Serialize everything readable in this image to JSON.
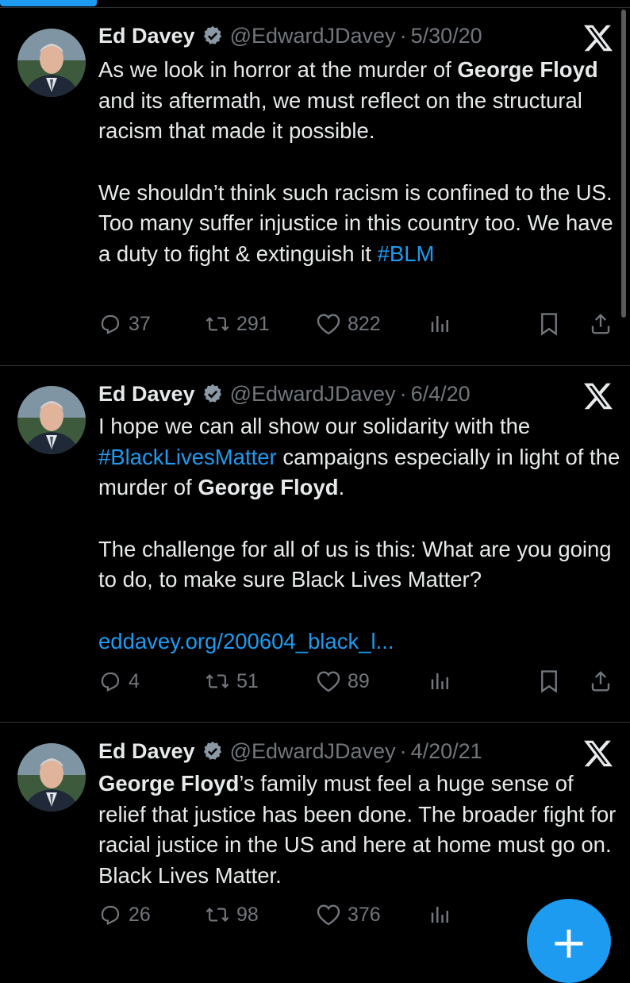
{
  "tweets": [
    {
      "name": "Ed Davey",
      "handle": "@EdwardJDavey",
      "dot": "·",
      "date": "5/30/20",
      "paragraphs": [
        [
          {
            "text": "As we look in horror at the murder of ",
            "style": "normal"
          },
          {
            "text": "George Floyd",
            "style": "bold"
          },
          {
            "text": " and its aftermath, we must reflect on the structural racism that made it possible.",
            "style": "normal"
          }
        ],
        [
          {
            "text": "We shouldn’t think such racism is confined to the US. Too many suffer injustice in this country too. We have a duty to fight & extinguish it ",
            "style": "normal"
          },
          {
            "text": "#BLM",
            "style": "link"
          }
        ]
      ],
      "replies": "37",
      "retweets": "291",
      "likes": "822"
    },
    {
      "name": "Ed Davey",
      "handle": "@EdwardJDavey",
      "dot": "·",
      "date": "6/4/20",
      "paragraphs": [
        [
          {
            "text": "I hope we can all show our solidarity with the ",
            "style": "normal"
          },
          {
            "text": "#BlackLivesMatter",
            "style": "link"
          },
          {
            "text": " campaigns especially in light of the murder of ",
            "style": "normal"
          },
          {
            "text": "George Floyd",
            "style": "bold"
          },
          {
            "text": ".",
            "style": "normal"
          }
        ],
        [
          {
            "text": "The challenge for all of us is this: What are you going to do, to make sure Black Lives Matter?",
            "style": "normal"
          }
        ],
        [
          {
            "text": "eddavey.org/200604_black_l...",
            "style": "link"
          }
        ]
      ],
      "replies": "4",
      "retweets": "51",
      "likes": "89"
    },
    {
      "name": "Ed Davey",
      "handle": "@EdwardJDavey",
      "dot": "·",
      "date": "4/20/21",
      "paragraphs": [
        [
          {
            "text": "George Floyd",
            "style": "bold"
          },
          {
            "text": "’s family must feel a huge sense of relief that justice has been done. The broader fight for racial justice in the US and here at home must go on. Black Lives Matter.",
            "style": "normal"
          }
        ]
      ],
      "replies": "26",
      "retweets": "98",
      "likes": "376"
    }
  ],
  "icons": {
    "verified": "verified-badge-icon",
    "x_logo": "x-logo-icon",
    "reply": "reply-icon",
    "retweet": "retweet-icon",
    "like": "heart-icon",
    "views": "analytics-icon",
    "bookmark": "bookmark-icon",
    "share": "share-icon",
    "compose": "plus-icon"
  },
  "colors": {
    "background": "#000000",
    "text": "#e7e9ea",
    "secondary": "#71767b",
    "accent": "#1d9bf0",
    "divider": "#2f3336"
  },
  "compose_label": "+"
}
